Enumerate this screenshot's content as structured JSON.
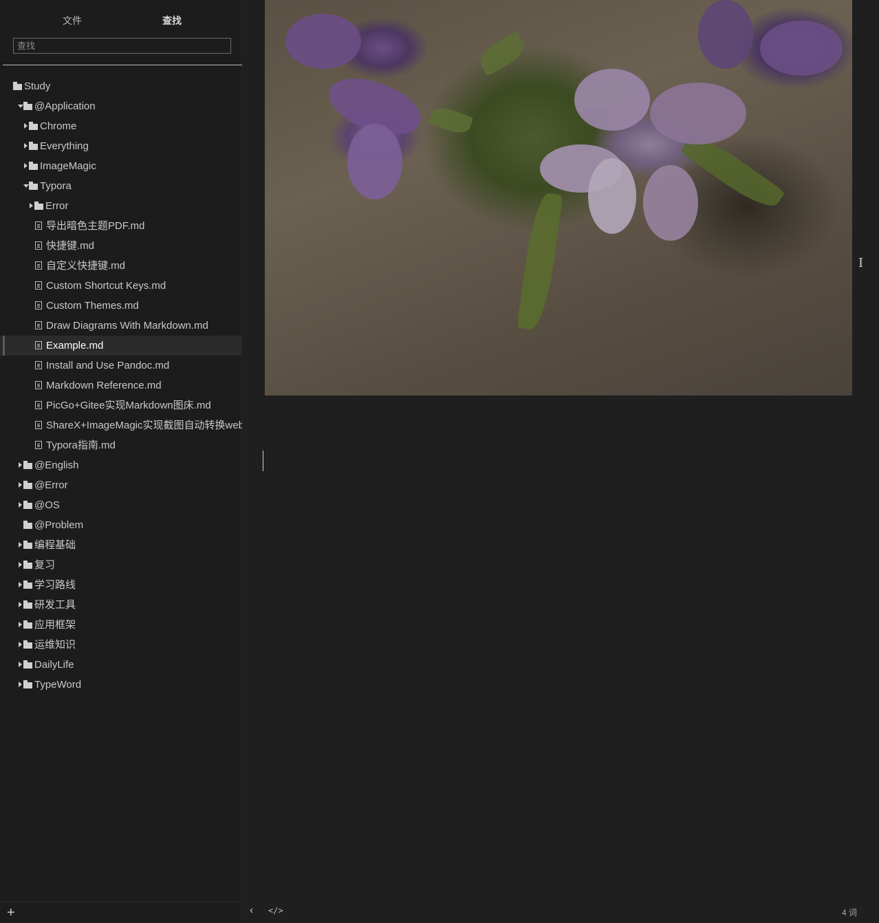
{
  "sidebar": {
    "tabs": [
      {
        "label": "文件",
        "active": false
      },
      {
        "label": "查找",
        "active": true
      }
    ],
    "search": {
      "placeholder": "查找",
      "value": ""
    },
    "tree": [
      {
        "label": "Study",
        "type": "folder",
        "depth": 0,
        "caret": "none"
      },
      {
        "label": "@Application",
        "type": "folder",
        "depth": 1,
        "caret": "down"
      },
      {
        "label": "Chrome",
        "type": "folder",
        "depth": 2,
        "caret": "right"
      },
      {
        "label": "Everything",
        "type": "folder",
        "depth": 2,
        "caret": "right"
      },
      {
        "label": "ImageMagic",
        "type": "folder",
        "depth": 2,
        "caret": "right"
      },
      {
        "label": "Typora",
        "type": "folder",
        "depth": 2,
        "caret": "down"
      },
      {
        "label": "Error",
        "type": "folder",
        "depth": 3,
        "caret": "right"
      },
      {
        "label": "导出暗色主题PDF.md",
        "type": "file",
        "depth": 3
      },
      {
        "label": "快捷键.md",
        "type": "file",
        "depth": 3
      },
      {
        "label": "自定义快捷键.md",
        "type": "file",
        "depth": 3
      },
      {
        "label": "Custom Shortcut Keys.md",
        "type": "file",
        "depth": 3
      },
      {
        "label": "Custom Themes.md",
        "type": "file",
        "depth": 3
      },
      {
        "label": "Draw Diagrams With Markdown.md",
        "type": "file",
        "depth": 3
      },
      {
        "label": "Example.md",
        "type": "file",
        "depth": 3,
        "selected": true
      },
      {
        "label": "Install and Use Pandoc.md",
        "type": "file",
        "depth": 3
      },
      {
        "label": "Markdown Reference.md",
        "type": "file",
        "depth": 3
      },
      {
        "label": "PicGo+Gitee实现Markdown图床.md",
        "type": "file",
        "depth": 3
      },
      {
        "label": "ShareX+ImageMagic实现截图自动转换webp",
        "type": "file",
        "depth": 3
      },
      {
        "label": "Typora指南.md",
        "type": "file",
        "depth": 3
      },
      {
        "label": "@English",
        "type": "folder",
        "depth": 1,
        "caret": "right"
      },
      {
        "label": "@Error",
        "type": "folder",
        "depth": 1,
        "caret": "right"
      },
      {
        "label": "@OS",
        "type": "folder",
        "depth": 1,
        "caret": "right"
      },
      {
        "label": "@Problem",
        "type": "folder",
        "depth": 1,
        "caret": "none"
      },
      {
        "label": "编程基础",
        "type": "folder",
        "depth": 1,
        "caret": "right"
      },
      {
        "label": "复习",
        "type": "folder",
        "depth": 1,
        "caret": "right"
      },
      {
        "label": "学习路线",
        "type": "folder",
        "depth": 1,
        "caret": "right"
      },
      {
        "label": "研发工具",
        "type": "folder",
        "depth": 1,
        "caret": "right"
      },
      {
        "label": "应用框架",
        "type": "folder",
        "depth": 1,
        "caret": "right"
      },
      {
        "label": "运维知识",
        "type": "folder",
        "depth": 1,
        "caret": "right"
      },
      {
        "label": "DailyLife",
        "type": "folder",
        "depth": 1,
        "caret": "right"
      },
      {
        "label": "TypeWord",
        "type": "folder",
        "depth": 1,
        "caret": "right"
      }
    ],
    "footer": {
      "add_icon": "plus-icon",
      "add_glyph": "+"
    }
  },
  "editor": {
    "image_description_icon": "photo-image"
  },
  "status_bar": {
    "back_glyph": "‹",
    "source_glyph": "</>",
    "word_count": "4 词"
  }
}
